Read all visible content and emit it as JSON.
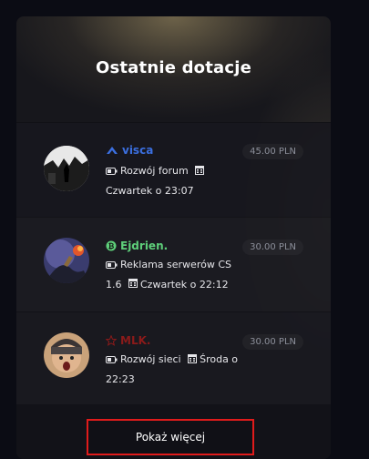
{
  "title": "Ostatnie dotacje",
  "donations": [
    {
      "name": "visca",
      "name_color": "#3b6fe0",
      "name_icon": "chevron-rank-icon",
      "amount": "45.00 PLN",
      "purpose": "Rozwój forum",
      "time": "Czwartek o 23:07"
    },
    {
      "name": "Ejdrien.",
      "name_color": "#5ecf7a",
      "name_icon": "coin-rank-icon",
      "amount": "30.00 PLN",
      "purpose": "Reklama serwerów CS 1.6",
      "time": "Czwartek o 22:12"
    },
    {
      "name": "MLK.",
      "name_color": "#8b1a1a",
      "name_icon": "star-outline-icon",
      "amount": "30.00 PLN",
      "purpose": "Rozwój sieci",
      "time": "Środa o 22:23"
    }
  ],
  "button": {
    "label": "Pokaż więcej"
  }
}
